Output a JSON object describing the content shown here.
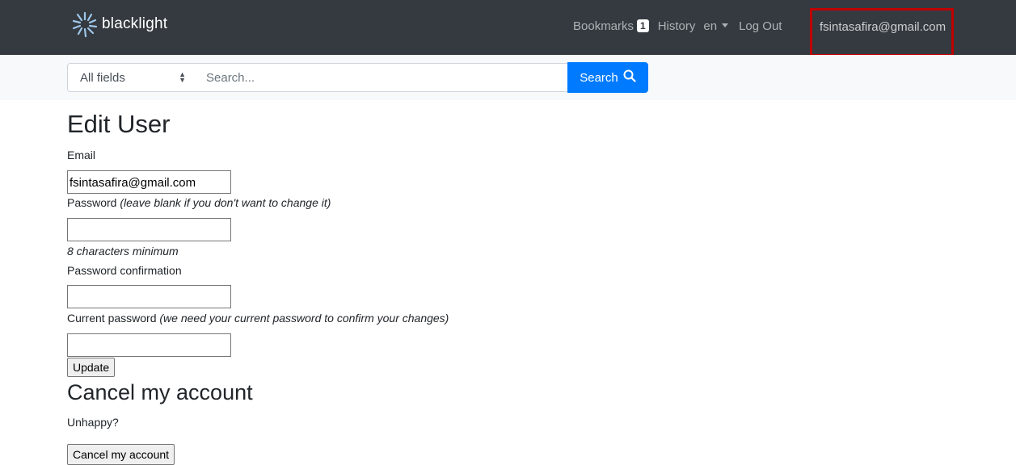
{
  "navbar": {
    "brand": "blacklight",
    "bookmarks_label": "Bookmarks",
    "bookmarks_count": "1",
    "history_label": "History",
    "language": "en",
    "logout_label": "Log Out",
    "user_email": "fsintasafira@gmail.com",
    "highlight_color": "#c00000"
  },
  "search": {
    "field_selected": "All fields",
    "placeholder": "Search...",
    "button_label": "Search"
  },
  "form": {
    "title": "Edit User",
    "email_label": "Email",
    "email_value": "fsintasafira@gmail.com",
    "password_label": "Password",
    "password_hint": "(leave blank if you don't want to change it)",
    "password_min_note": "8 characters minimum",
    "password_confirmation_label": "Password confirmation",
    "current_password_label": "Current password",
    "current_password_hint": "(we need your current password to confirm your changes)",
    "update_button": "Update"
  },
  "cancel_section": {
    "title": "Cancel my account",
    "prompt": "Unhappy?",
    "button": "Cancel my account"
  },
  "icons": {
    "brand": "blacklight-logo-icon",
    "search": "magnifier-icon",
    "language": "caret-down-icon",
    "select": "up-down-arrows-icon"
  },
  "colors": {
    "navbar_bg": "#343a40",
    "search_bg": "#f8f9fa",
    "primary": "#007bff"
  }
}
